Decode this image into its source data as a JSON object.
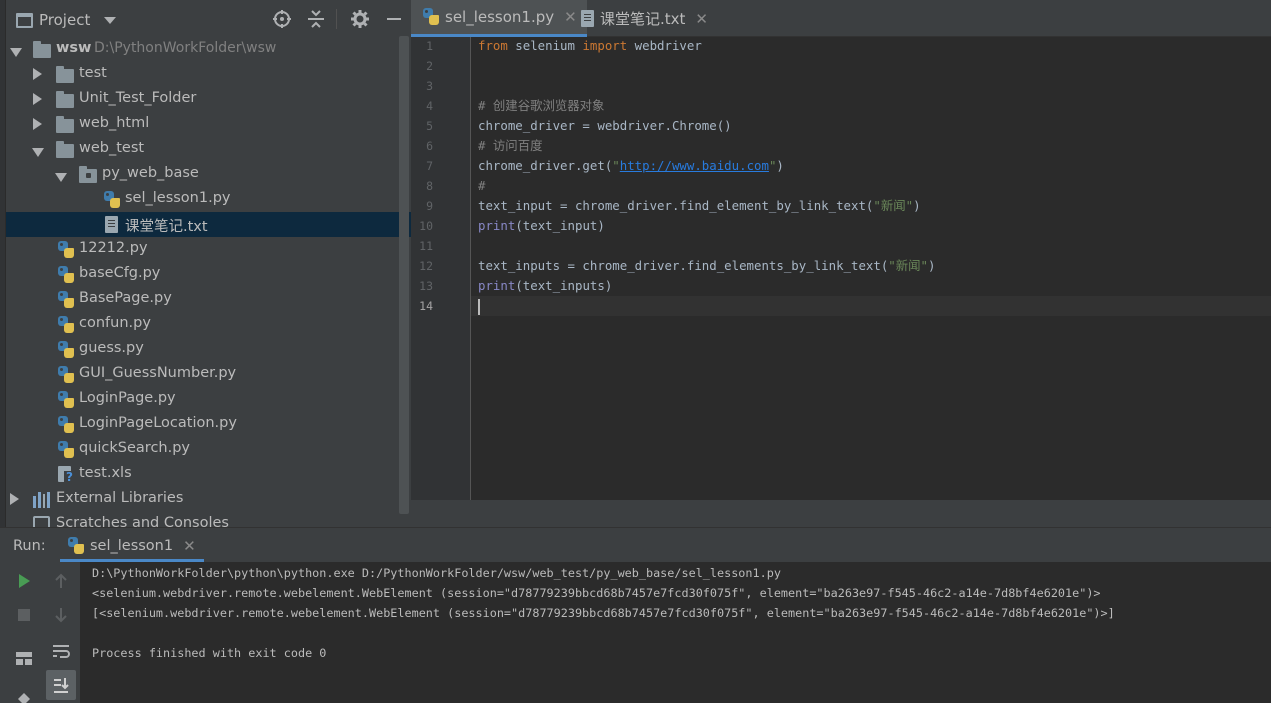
{
  "project_panel": {
    "title": "Project",
    "tree": [
      {
        "label": "wsw",
        "path": "D:\\PythonWorkFolder\\wsw"
      },
      {
        "label": "test"
      },
      {
        "label": "Unit_Test_Folder"
      },
      {
        "label": "web_html"
      },
      {
        "label": "web_test"
      },
      {
        "label": "py_web_base"
      },
      {
        "label": "sel_lesson1.py"
      },
      {
        "label": "课堂笔记.txt"
      },
      {
        "label": "12212.py"
      },
      {
        "label": "baseCfg.py"
      },
      {
        "label": "BasePage.py"
      },
      {
        "label": "confun.py"
      },
      {
        "label": "guess.py"
      },
      {
        "label": "GUI_GuessNumber.py"
      },
      {
        "label": "LoginPage.py"
      },
      {
        "label": "LoginPageLocation.py"
      },
      {
        "label": "quickSearch.py"
      },
      {
        "label": "test.xls"
      },
      {
        "label": "External Libraries"
      },
      {
        "label": "Scratches and Consoles"
      }
    ]
  },
  "editor": {
    "tabs": [
      {
        "label": "sel_lesson1.py",
        "active": true
      },
      {
        "label": "课堂笔记.txt",
        "active": false
      }
    ],
    "current_line": 14,
    "lines": [
      {
        "n": "1",
        "parts": [
          {
            "t": "from",
            "c": "kw"
          },
          {
            "t": " selenium ",
            "c": ""
          },
          {
            "t": "import",
            "c": "kw"
          },
          {
            "t": " webdriver",
            "c": ""
          }
        ]
      },
      {
        "n": "2",
        "parts": []
      },
      {
        "n": "3",
        "parts": []
      },
      {
        "n": "4",
        "parts": [
          {
            "t": "# 创建谷歌浏览器对象",
            "c": "cm"
          }
        ]
      },
      {
        "n": "5",
        "parts": [
          {
            "t": "chrome_driver = webdriver.Chrome()",
            "c": ""
          }
        ]
      },
      {
        "n": "6",
        "parts": [
          {
            "t": "# 访问百度",
            "c": "cm"
          }
        ]
      },
      {
        "n": "7",
        "parts": [
          {
            "t": "chrome_driver.get(",
            "c": ""
          },
          {
            "t": "\"",
            "c": "str"
          },
          {
            "t": "http://www.baidu.com",
            "c": "url"
          },
          {
            "t": "\"",
            "c": "str"
          },
          {
            "t": ")",
            "c": ""
          }
        ]
      },
      {
        "n": "8",
        "parts": [
          {
            "t": "#",
            "c": "cm"
          }
        ]
      },
      {
        "n": "9",
        "parts": [
          {
            "t": "text_input = chrome_driver.find_element_by_link_text(",
            "c": ""
          },
          {
            "t": "\"新闻\"",
            "c": "str"
          },
          {
            "t": ")",
            "c": ""
          }
        ]
      },
      {
        "n": "10",
        "parts": [
          {
            "t": "print",
            "c": "bi"
          },
          {
            "t": "(text_input)",
            "c": ""
          }
        ]
      },
      {
        "n": "11",
        "parts": []
      },
      {
        "n": "12",
        "parts": [
          {
            "t": "text_inputs = chrome_driver.find_elements_by_link_text(",
            "c": ""
          },
          {
            "t": "\"新闻\"",
            "c": "str"
          },
          {
            "t": ")",
            "c": ""
          }
        ]
      },
      {
        "n": "13",
        "parts": [
          {
            "t": "print",
            "c": "bi"
          },
          {
            "t": "(text_inputs)",
            "c": ""
          }
        ]
      },
      {
        "n": "14",
        "parts": []
      }
    ]
  },
  "run_panel": {
    "label": "Run:",
    "tab_label": "sel_lesson1",
    "console_lines": [
      "D:\\PythonWorkFolder\\python\\python.exe D:/PythonWorkFolder/wsw/web_test/py_web_base/sel_lesson1.py",
      "<selenium.webdriver.remote.webelement.WebElement (session=\"d78779239bbcd68b7457e7fcd30f075f\", element=\"ba263e97-f545-46c2-a14e-7d8bf4e6201e\")>",
      "[<selenium.webdriver.remote.webelement.WebElement (session=\"d78779239bbcd68b7457e7fcd30f075f\", element=\"ba263e97-f545-46c2-a14e-7d8bf4e6201e\")>]",
      "",
      "Process finished with exit code 0"
    ]
  },
  "colors": {
    "selection": "#0d293e",
    "accent": "#4a88c7",
    "keyword": "#cc7832",
    "string": "#6a8759",
    "comment": "#808080",
    "builtin": "#8888c6",
    "link": "#287bde",
    "run_green": "#499c54"
  },
  "icons": {
    "project_header": [
      "project-window-icon",
      "locate-crosshair-icon",
      "collapse-all-icon",
      "gear-icon",
      "minimize-icon"
    ],
    "run_toolbar": [
      "play-icon",
      "stop-icon",
      "layout-icon",
      "pin-icon",
      "arrow-up-icon",
      "arrow-down-icon",
      "soft-wrap-icon",
      "scroll-to-end-icon"
    ]
  }
}
